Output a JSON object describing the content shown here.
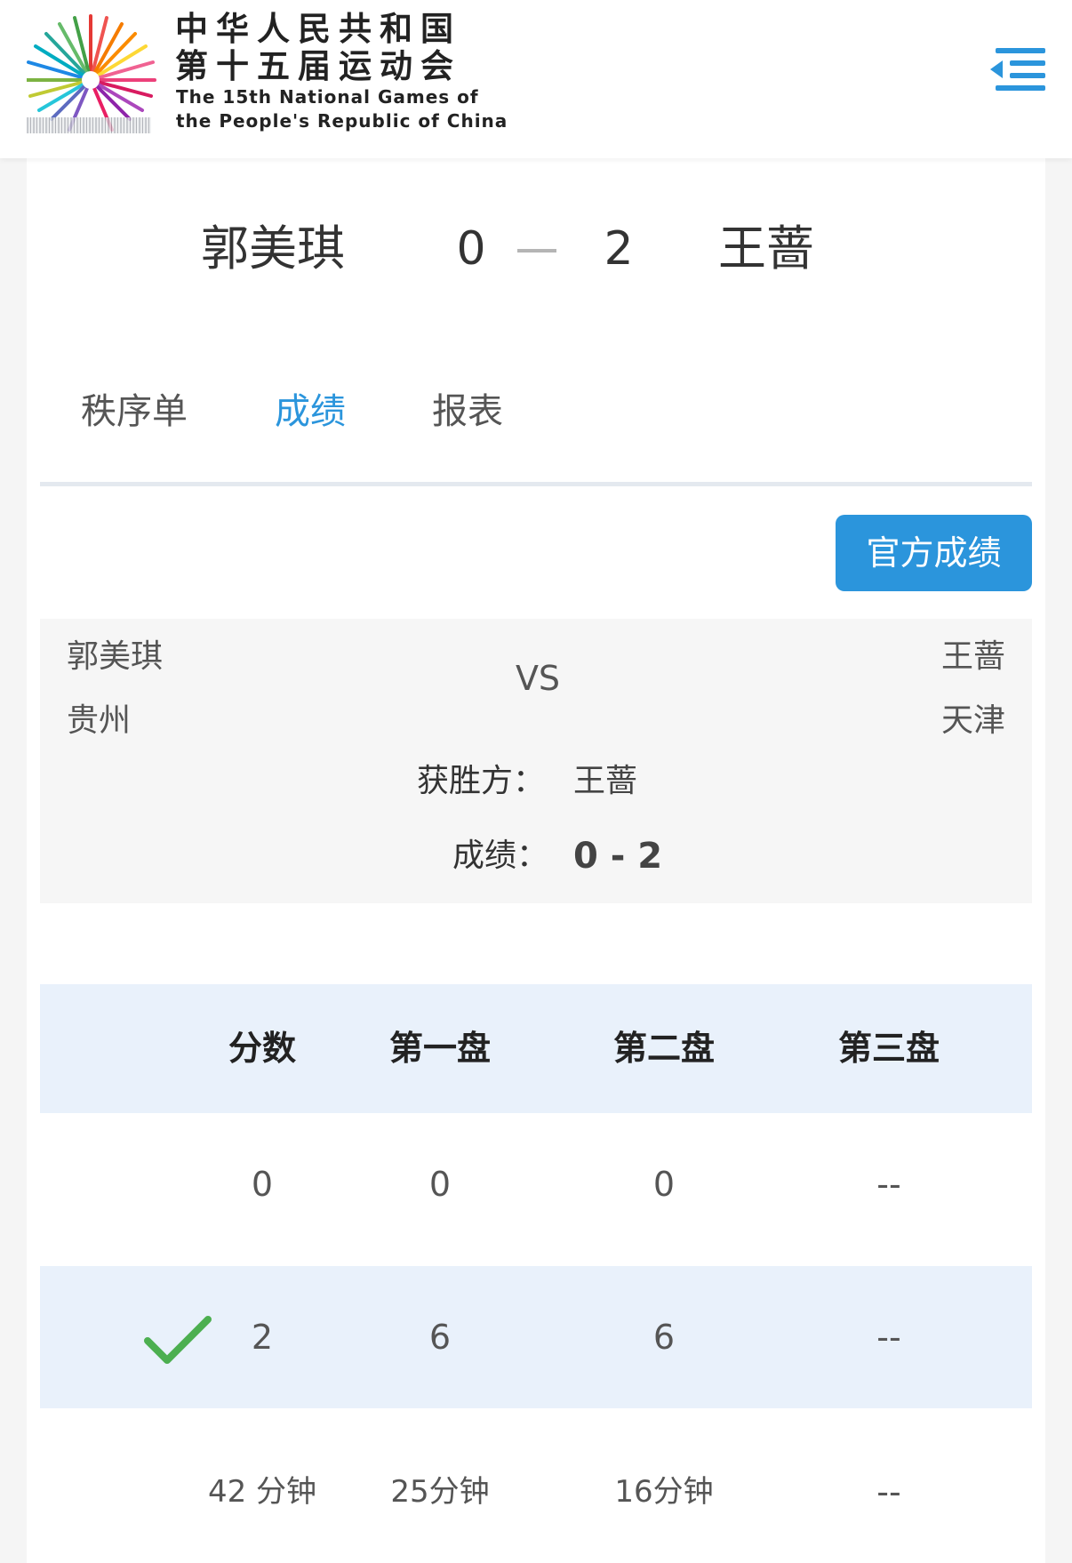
{
  "header": {
    "title_cn_line1": "中华人民共和国",
    "title_cn_line2": "第十五届运动会",
    "title_en_line1": "The 15th National Games of",
    "title_en_line2": "the People's Republic of China",
    "menu_icon": "menu-indent-icon"
  },
  "scoreboard": {
    "player1": "郭美琪",
    "score1": "0",
    "score2": "2",
    "player2": "王蔷"
  },
  "tabs": [
    {
      "label": "秩序单",
      "active": false
    },
    {
      "label": "成绩",
      "active": true
    },
    {
      "label": "报表",
      "active": false
    }
  ],
  "official_button": "官方成绩",
  "match": {
    "player1_name": "郭美琪",
    "player1_team": "贵州",
    "vs": "VS",
    "player2_name": "王蔷",
    "player2_team": "天津",
    "winner_label": "获胜方：",
    "winner_value": "王蔷",
    "result_label": "成绩：",
    "result_value": "0 - 2"
  },
  "table": {
    "headers": [
      "分数",
      "第一盘",
      "第二盘",
      "第三盘"
    ],
    "rows": [
      {
        "winner": false,
        "cells": [
          "0",
          "0",
          "0",
          "--"
        ]
      },
      {
        "winner": true,
        "cells": [
          "2",
          "6",
          "6",
          "--"
        ]
      },
      {
        "winner": false,
        "cells": [
          "42 分钟",
          "25分钟",
          "16分钟",
          "--"
        ]
      }
    ]
  },
  "colors": {
    "accent": "#2b95dc",
    "table_header_bg": "#e9f1fb",
    "check": "#4caf50"
  }
}
